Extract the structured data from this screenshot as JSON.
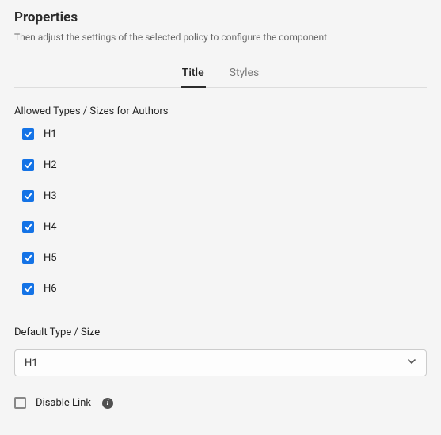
{
  "header": {
    "title": "Properties",
    "description": "Then adjust the settings of the selected policy to configure the component"
  },
  "tabs": {
    "title": "Title",
    "styles": "Styles"
  },
  "allowed": {
    "label": "Allowed Types / Sizes for Authors",
    "items": [
      {
        "label": "H1",
        "checked": true
      },
      {
        "label": "H2",
        "checked": true
      },
      {
        "label": "H3",
        "checked": true
      },
      {
        "label": "H4",
        "checked": true
      },
      {
        "label": "H5",
        "checked": true
      },
      {
        "label": "H6",
        "checked": true
      }
    ]
  },
  "defaultType": {
    "label": "Default Type / Size",
    "value": "H1"
  },
  "disableLink": {
    "label": "Disable Link",
    "checked": false
  }
}
